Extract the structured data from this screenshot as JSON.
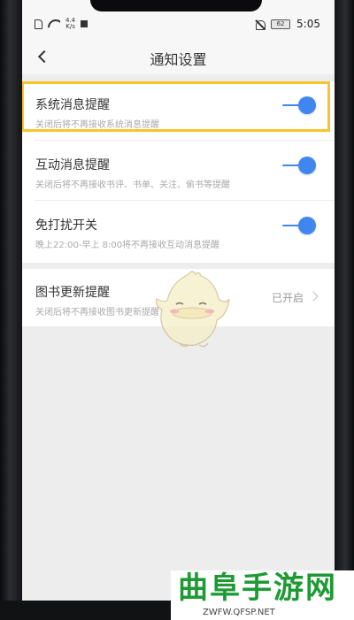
{
  "status_bar": {
    "speed_value": "4.4",
    "speed_unit": "K/s",
    "battery": "62",
    "time": "5:05"
  },
  "header": {
    "title": "通知设置"
  },
  "settings": [
    {
      "title": "系统消息提醒",
      "subtitle": "关闭后将不再接收系统消息提醒",
      "enabled": true
    },
    {
      "title": "互动消息提醒",
      "subtitle": "关闭后将不再接收书评、书单、关注、偷书等提醒",
      "enabled": true
    },
    {
      "title": "免打扰开关",
      "subtitle": "晚上22:00-早上 8:00将不再接收互动消息提醒",
      "enabled": true
    }
  ],
  "book_update": {
    "title": "图书更新提醒",
    "subtitle": "关闭后将不再接收图书更新提醒",
    "status": "已开启"
  },
  "watermark": {
    "brand": "曲阜手游网",
    "url": "ZWFW.QFSP.NET"
  },
  "colors": {
    "accent": "#3f86f1",
    "highlight": "#f6c52d",
    "watermark": "#1d9a34"
  }
}
